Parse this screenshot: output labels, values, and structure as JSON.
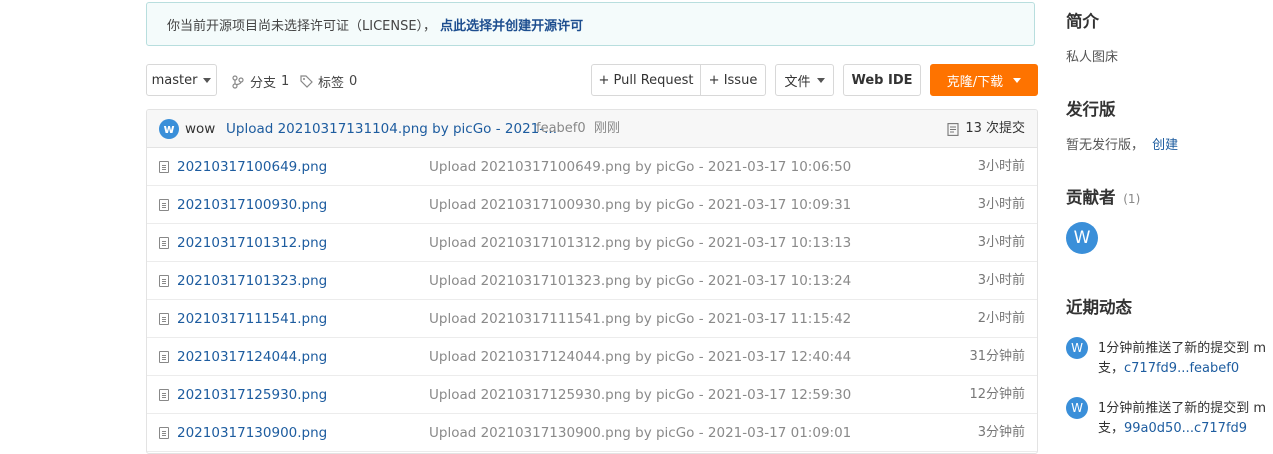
{
  "notice": {
    "text": "你当前开源项目尚未选择许可证（LICENSE），",
    "link": "点此选择并创建开源许可"
  },
  "toolbar": {
    "branch": "master",
    "branches_label": "分支",
    "branches_count": "1",
    "tags_label": "标签",
    "tags_count": "0",
    "pull_request": "+ Pull Request",
    "issue": "+ Issue",
    "file": "文件",
    "web_ide": "Web IDE",
    "clone": "克隆/下载"
  },
  "commit": {
    "avatar": "w",
    "author": "wow",
    "message": "Upload 20210317131104.png by picGo - 2021-...",
    "hash": "feabef0",
    "time": "刚刚",
    "count_label": "13 次提交"
  },
  "files": [
    {
      "name": "20210317100649.png",
      "message": "Upload 20210317100649.png by picGo - 2021-03-17 10:06:50",
      "time": "3小时前"
    },
    {
      "name": "20210317100930.png",
      "message": "Upload 20210317100930.png by picGo - 2021-03-17 10:09:31",
      "time": "3小时前"
    },
    {
      "name": "20210317101312.png",
      "message": "Upload 20210317101312.png by picGo - 2021-03-17 10:13:13",
      "time": "3小时前"
    },
    {
      "name": "20210317101323.png",
      "message": "Upload 20210317101323.png by picGo - 2021-03-17 10:13:24",
      "time": "3小时前"
    },
    {
      "name": "20210317111541.png",
      "message": "Upload 20210317111541.png by picGo - 2021-03-17 11:15:42",
      "time": "2小时前"
    },
    {
      "name": "20210317124044.png",
      "message": "Upload 20210317124044.png by picGo - 2021-03-17 12:40:44",
      "time": "31分钟前"
    },
    {
      "name": "20210317125930.png",
      "message": "Upload 20210317125930.png by picGo - 2021-03-17 12:59:30",
      "time": "12分钟前"
    },
    {
      "name": "20210317130900.png",
      "message": "Upload 20210317130900.png by picGo - 2021-03-17 01:09:01",
      "time": "3分钟前"
    }
  ],
  "sidebar": {
    "intro_title": "简介",
    "intro_text": "私人图床",
    "release_title": "发行版",
    "release_text": "暂无发行版，",
    "release_link": "创建",
    "contrib_title": "贡献者",
    "contrib_count": "(1)",
    "contrib_avatar": "W",
    "activity_title": "近期动态",
    "activities": [
      {
        "avatar": "W",
        "line1": "1分钟前推送了新的提交到 m",
        "line2_prefix": "支，",
        "line2_link": "c717fd9...feabef0"
      },
      {
        "avatar": "W",
        "line1": "1分钟前推送了新的提交到 m",
        "line2_prefix": "支，",
        "line2_link": "99a0d50...c717fd9"
      }
    ]
  },
  "colors": {
    "accent": "#fe7300",
    "link": "#1d5c9f",
    "avatar": "#3a8fd9"
  }
}
